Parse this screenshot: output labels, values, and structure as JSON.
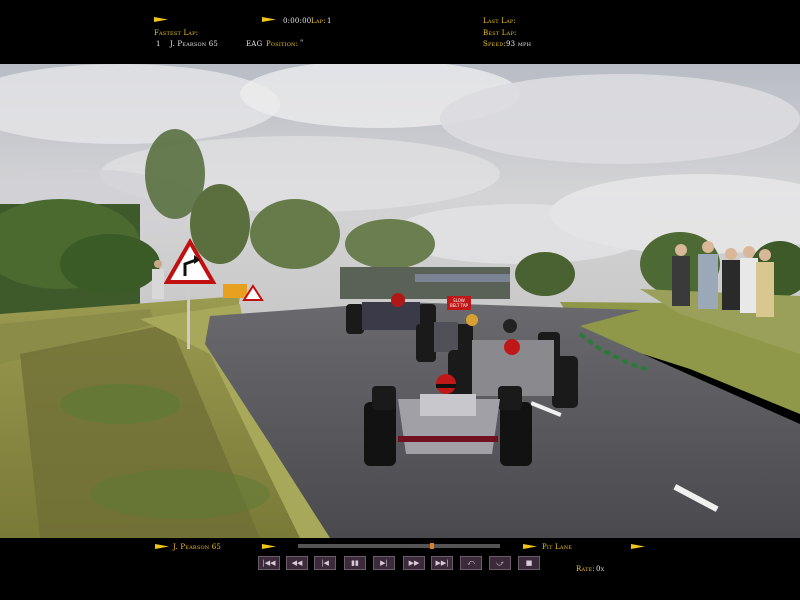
{
  "top_hud": {
    "race_time": "0:00:00",
    "lap_label": "Lap:",
    "lap_value": "1",
    "fastest_lap_label": "Fastest Lap:",
    "fastest_pos": "1",
    "fastest_driver": "J. Pearson 65",
    "fastest_code": "EAG",
    "position_label": "Position:",
    "position_value": "\"",
    "last_lap_label": "Last Lap:",
    "best_lap_label": "Best Lap:",
    "speed_label": "Speed:",
    "speed_value": "93 mph"
  },
  "scene": {
    "sign_text_1": "SLOW",
    "sign_text_2": "BELT TAP"
  },
  "bottom_hud": {
    "driver": "J. Pearson 65",
    "pit_lane_label": "Pit Lane",
    "rate_label": "Rate:",
    "rate_value": "0x",
    "controls": [
      "|◀◀",
      "◀◀",
      "|◀",
      "▮▮",
      "▶|",
      "▶▶",
      "▶▶|",
      "⤺",
      "⤻",
      "■",
      "⏏"
    ]
  },
  "colors": {
    "hud_text": "#f0c419",
    "hud_bg": "#000000"
  }
}
